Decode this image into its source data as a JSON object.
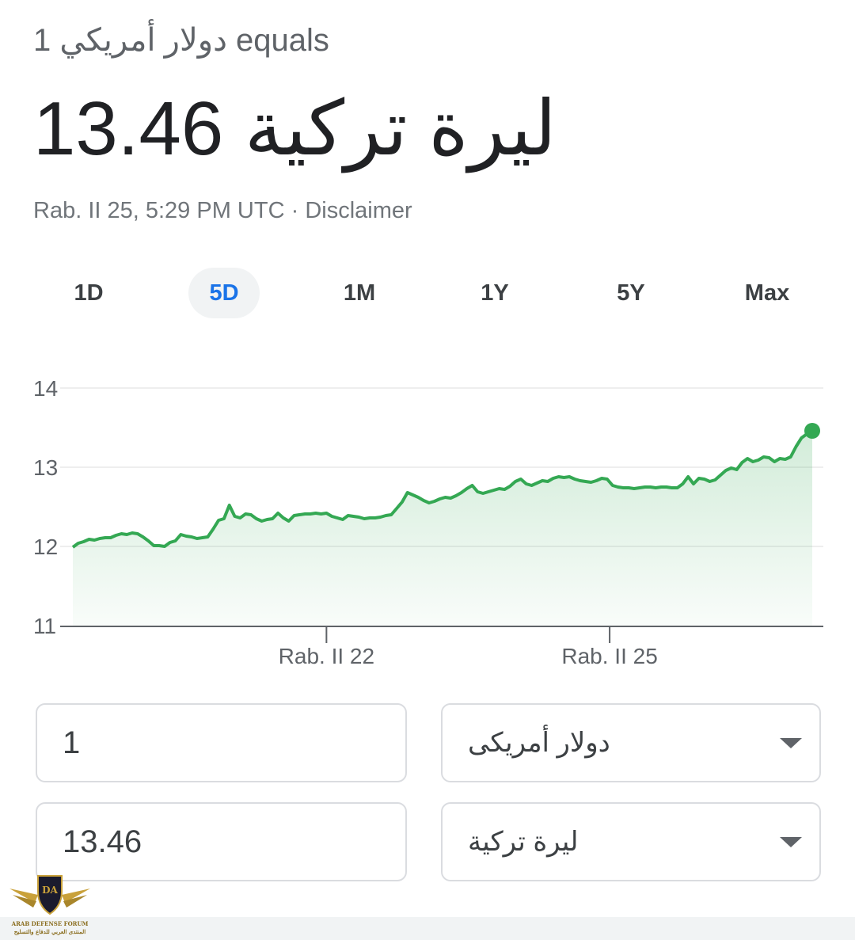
{
  "header": {
    "equals_text": "1 دولار أمريكي equals",
    "value": "13.46",
    "currency": "ليرة تركية",
    "timestamp": "Rab. II 25, 5:29 PM UTC",
    "separator": "·",
    "disclaimer": "Disclaimer"
  },
  "tabs": [
    {
      "label": "1D",
      "active": false
    },
    {
      "label": "5D",
      "active": true
    },
    {
      "label": "1M",
      "active": false
    },
    {
      "label": "1Y",
      "active": false
    },
    {
      "label": "5Y",
      "active": false
    },
    {
      "label": "Max",
      "active": false
    }
  ],
  "chart_data": {
    "type": "line",
    "ylim": [
      11,
      14
    ],
    "yticks": [
      "14",
      "13",
      "12",
      "11"
    ],
    "xticks": [
      {
        "label": "Rab. II 22",
        "t": 0.343
      },
      {
        "label": "Rab. II 25",
        "t": 0.726
      }
    ],
    "grid": true,
    "line_color": "#34a853",
    "values": [
      11.99,
      12.04,
      12.06,
      12.09,
      12.08,
      12.1,
      12.11,
      12.11,
      12.14,
      12.16,
      12.15,
      12.17,
      12.16,
      12.12,
      12.07,
      12.01,
      12.01,
      12.0,
      12.05,
      12.07,
      12.15,
      12.13,
      12.12,
      12.1,
      12.11,
      12.12,
      12.22,
      12.33,
      12.35,
      12.52,
      12.38,
      12.36,
      12.41,
      12.4,
      12.35,
      12.32,
      12.34,
      12.35,
      12.42,
      12.36,
      12.32,
      12.39,
      12.4,
      12.41,
      12.41,
      12.42,
      12.41,
      12.42,
      12.38,
      12.36,
      12.34,
      12.39,
      12.38,
      12.37,
      12.35,
      12.36,
      12.36,
      12.37,
      12.39,
      12.4,
      12.48,
      12.56,
      12.68,
      12.65,
      12.62,
      12.58,
      12.55,
      12.57,
      12.6,
      12.62,
      12.61,
      12.64,
      12.68,
      12.73,
      12.77,
      12.69,
      12.67,
      12.69,
      12.71,
      12.73,
      12.72,
      12.76,
      12.82,
      12.85,
      12.79,
      12.77,
      12.8,
      12.83,
      12.82,
      12.86,
      12.88,
      12.87,
      12.88,
      12.85,
      12.83,
      12.82,
      12.81,
      12.83,
      12.86,
      12.85,
      12.77,
      12.75,
      12.74,
      12.74,
      12.73,
      12.74,
      12.75,
      12.75,
      12.74,
      12.75,
      12.75,
      12.74,
      12.74,
      12.79,
      12.88,
      12.79,
      12.86,
      12.85,
      12.82,
      12.84,
      12.9,
      12.96,
      12.99,
      12.97,
      13.06,
      13.11,
      13.07,
      13.09,
      13.13,
      13.12,
      13.07,
      13.11,
      13.1,
      13.13,
      13.26,
      13.37,
      13.42,
      13.46
    ],
    "last_value": 13.46
  },
  "converter": {
    "from_amount": "1",
    "from_currency": "دولار أمريكى",
    "to_amount": "13.46",
    "to_currency": "ليرة تركية"
  },
  "watermark": {
    "logo_text": "DA",
    "name": "ARAB DEFENSE FORUM",
    "name_ar": "المنتدى العربي للدفاع والتسليح"
  }
}
